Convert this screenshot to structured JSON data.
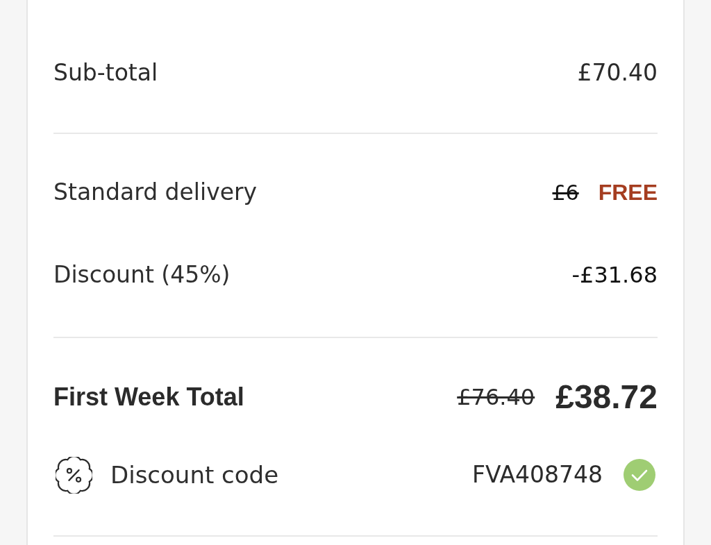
{
  "summary": {
    "subtotal": {
      "label": "Sub-total",
      "value": "£70.40"
    },
    "charges": [
      {
        "label": "Standard delivery",
        "original_price": "£6",
        "value": "FREE",
        "kind": "free"
      },
      {
        "label": "Discount (45%)",
        "value": "-£31.68",
        "kind": "discount"
      }
    ],
    "total": {
      "label": "First Week Total",
      "original_price": "£76.40",
      "value": "£38.72"
    },
    "discount_code": {
      "label": "Discount code",
      "code": "FVA408748",
      "applied": true
    }
  }
}
